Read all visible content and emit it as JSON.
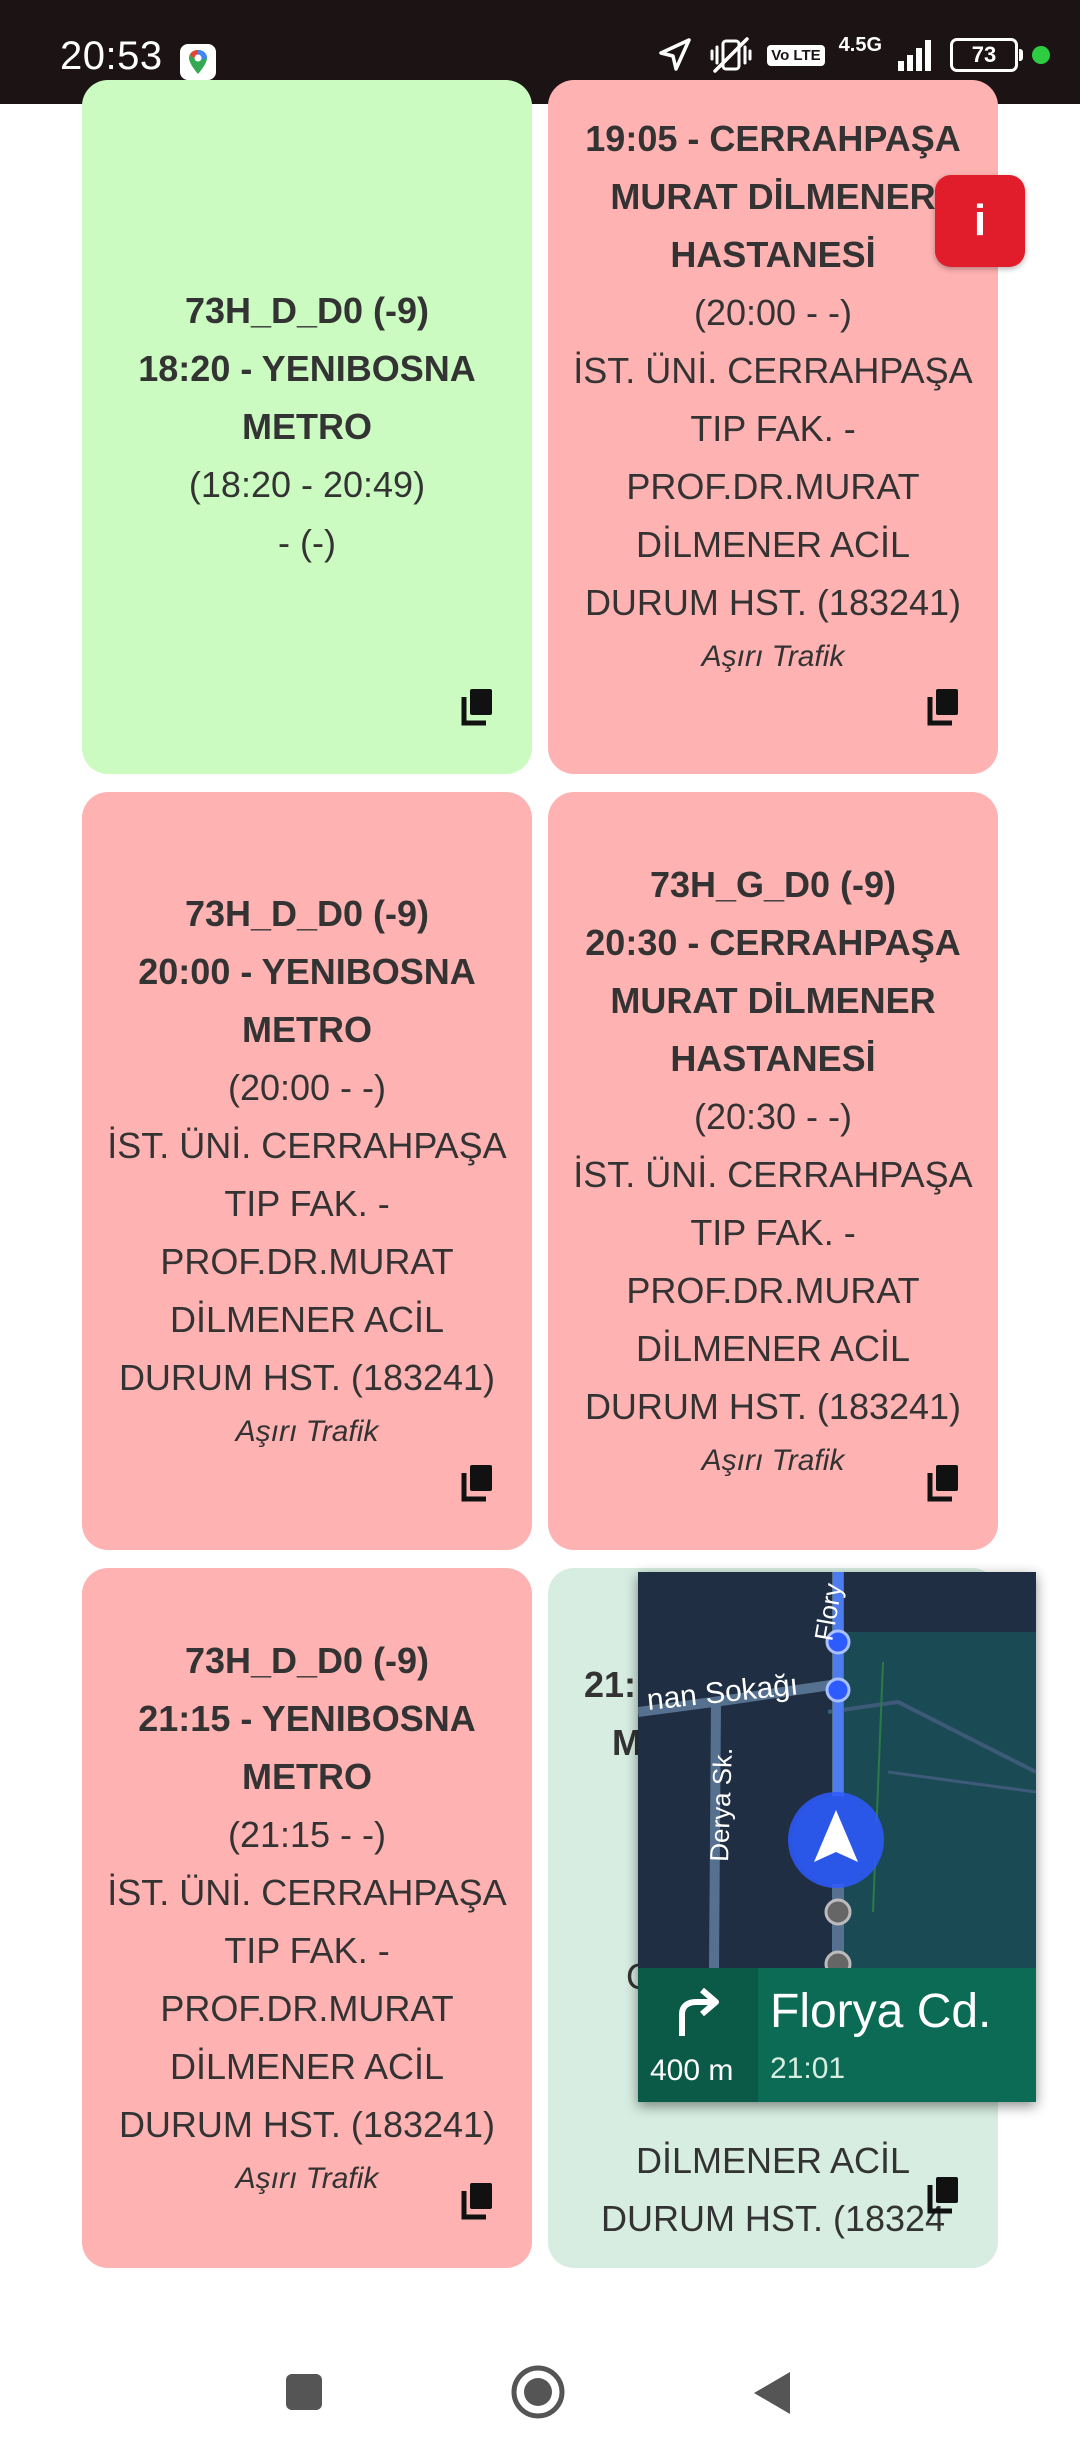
{
  "status_bar": {
    "time": "20:53",
    "network_badge": "Vo LTE",
    "network_type": "4.5G",
    "battery": "73"
  },
  "cards": [
    {
      "lines": [
        "73H_D_D0 (-9)",
        "18:20 - YENIBOSNA METRO",
        "(18:20 - 20:49)",
        "- (-)"
      ],
      "status": ""
    },
    {
      "lines": [
        "19:05 - CERRAHPAŞA MURAT DİLMENER HASTANESİ",
        "(20:00 - -)",
        "İST. ÜNİ. CERRAHPAŞA TIP FAK. - PROF.DR.MURAT DİLMENER ACİL DURUM HST. (183241)"
      ],
      "status": "Aşırı Trafik"
    },
    {
      "lines": [
        "73H_D_D0 (-9)",
        "20:00 - YENIBOSNA METRO",
        "(20:00 - -)",
        "İST. ÜNİ. CERRAHPAŞA TIP FAK. - PROF.DR.MURAT DİLMENER ACİL DURUM HST. (183241)"
      ],
      "status": "Aşırı Trafik"
    },
    {
      "lines": [
        "73H_G_D0 (-9)",
        "20:30 - CERRAHPAŞA MURAT DİLMENER HASTANESİ",
        "(20:30 - -)",
        "İST. ÜNİ. CERRAHPAŞA TIP FAK. - PROF.DR.MURAT DİLMENER ACİL DURUM HST. (183241)"
      ],
      "status": "Aşırı Trafik"
    },
    {
      "lines": [
        "73H_D_D0 (-9)",
        "21:15 - YENIBOSNA METRO",
        "(21:15 - -)",
        "İST. ÜNİ. CERRAHPAŞA TIP FAK. - PROF.DR.MURAT DİLMENER ACİL DURUM HST. (183241)"
      ],
      "status": "Aşırı Trafik"
    },
    {
      "partial_top": "21:",
      "partial_m": "M",
      "partial_c": "C",
      "lines": [
        "DİLMENER ACİL",
        "DURUM HST. (18324"
      ],
      "status": ""
    }
  ],
  "info_button": "i",
  "navigation": {
    "street_labels": [
      "Flory",
      "nan Sokağı",
      "Derya Sk."
    ],
    "distance": "400 m",
    "street": "Florya Cd.",
    "eta": "21:01",
    "turn_icon": "turn-right-arrow-icon"
  },
  "colors": {
    "green_card": "#ccfbc1",
    "red_card": "#ffb2b2",
    "mint_card": "#d7ede1",
    "nav_green": "#0b6b55",
    "info_red": "#e11d2b"
  }
}
